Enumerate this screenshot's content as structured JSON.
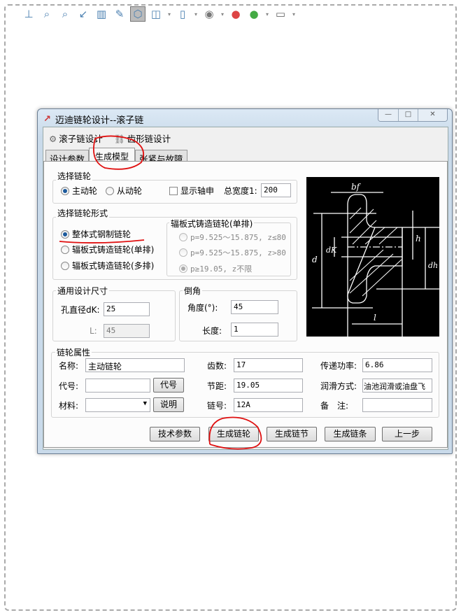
{
  "toolbar": {
    "icons": [
      "normal-to-icon",
      "zoom-to-fit-icon",
      "zoom-area-icon",
      "previous-view-icon",
      "section-view-icon",
      "dynamic-annotation-icon",
      "view-orientation-icon",
      "display-style-icon",
      "hide-show-icon",
      "edit-appearance-icon",
      "apply-scene-icon",
      "view-settings-icon"
    ]
  },
  "window": {
    "title": "迈迪链轮设计--滚子链",
    "min": "—",
    "max": "□",
    "close": "✕"
  },
  "menubar": {
    "roller": "滚子链设计",
    "tooth": "齿形链设计"
  },
  "tabs": [
    "设计参数",
    "生成模型",
    "张紧与故障"
  ],
  "select_sprocket": {
    "title": "选择链轮",
    "driving": "主动轮",
    "driven": "从动轮",
    "show_shaft": "显示轴申",
    "total_width_label": "总宽度1:",
    "total_width": "200"
  },
  "form": {
    "title": "选择链轮形式",
    "options": [
      "整体式钢制链轮",
      "辐板式铸造链轮(单排)",
      "辐板式铸造链轮(多排)"
    ],
    "sub_title": "辐板式铸造链轮(单排)",
    "sub_options": [
      "p=9.525～15.875, z≤80",
      "p=9.525～15.875, z>80",
      "p≥19.05, z不限"
    ]
  },
  "general": {
    "title": "通用设计尺寸",
    "bore_label": "孔直径dK:",
    "bore": "25",
    "L_label": "L:",
    "L": "45"
  },
  "chamfer": {
    "title": "倒角",
    "angle_label": "角度(°):",
    "angle": "45",
    "length_label": "长度:",
    "length": "1"
  },
  "diagram": {
    "labels": [
      "bf",
      "d",
      "dK",
      "h",
      "dh",
      "l"
    ]
  },
  "props": {
    "title": "链轮属性",
    "name_label": "名称:",
    "name": "主动链轮",
    "code_label": "代号:",
    "code": "",
    "code_btn": "代号",
    "material_label": "材料:",
    "material": "",
    "explain_btn": "说明",
    "teeth_label": "齿数:",
    "teeth": "17",
    "pitch_label": "节距:",
    "pitch": "19.05",
    "chain_no_label": "链号:",
    "chain_no": "12A",
    "power_label": "传递功率:",
    "power": "6.86",
    "lube_label": "润滑方式:",
    "lube": "油池润滑或油盘飞",
    "note_label": "备　注:",
    "note": ""
  },
  "buttons": {
    "tech": "技术参数",
    "gen_sprocket": "生成链轮",
    "gen_link": "生成链节",
    "gen_chain": "生成链条",
    "prev": "上一步"
  },
  "annotation_color": "#e01010"
}
